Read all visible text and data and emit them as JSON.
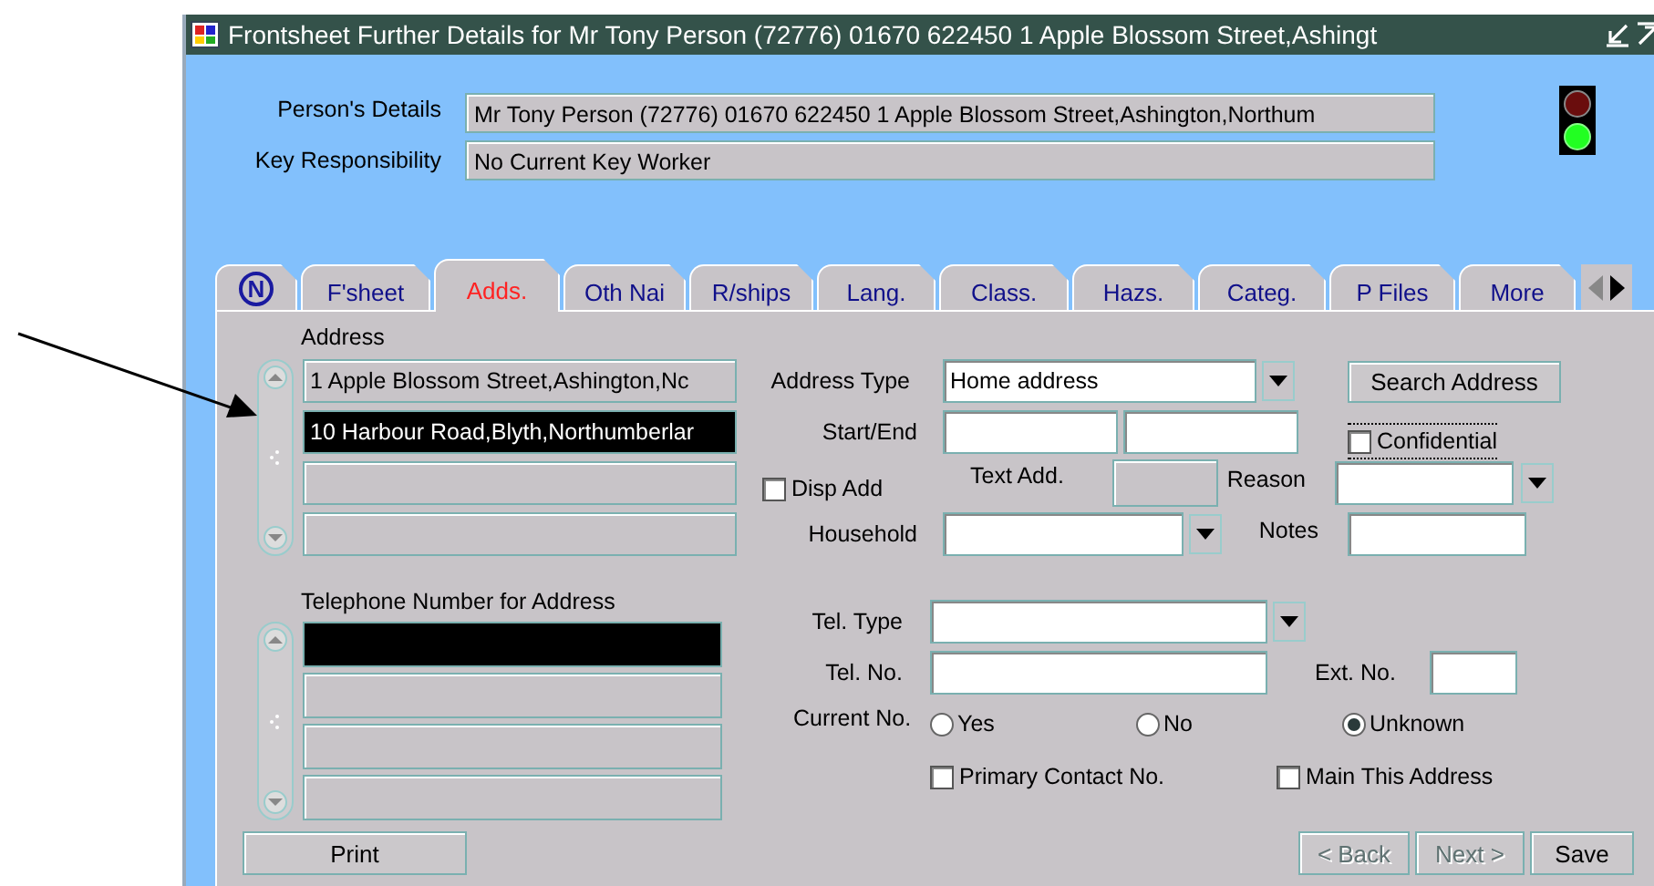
{
  "window": {
    "title": "Frontsheet Further Details for  Mr Tony Person (72776) 01670 622450 1 Apple Blossom Street,Ashingt"
  },
  "header": {
    "fields": [
      {
        "label": "Person's Details",
        "value": "Mr Tony Person (72776) 01670 622450 1  Apple Blossom Street,Ashington,Northum"
      },
      {
        "label": "Key Responsibility",
        "value": "No Current Key Worker"
      }
    ],
    "traffic_light": {
      "red_lit": false,
      "green_lit": true
    }
  },
  "tabs": [
    {
      "kind": "icon",
      "label": "N",
      "selected": false
    },
    {
      "kind": "text",
      "label": "F'sheet",
      "selected": false
    },
    {
      "kind": "text",
      "label": "Adds.",
      "selected": true
    },
    {
      "kind": "text",
      "label": "Oth Nai",
      "selected": false
    },
    {
      "kind": "text",
      "label": "R/ships",
      "selected": false
    },
    {
      "kind": "text",
      "label": "Lang.",
      "selected": false
    },
    {
      "kind": "text",
      "label": "Class.",
      "selected": false
    },
    {
      "kind": "text",
      "label": "Hazs.",
      "selected": false
    },
    {
      "kind": "text",
      "label": "Categ.",
      "selected": false
    },
    {
      "kind": "text",
      "label": "P Files",
      "selected": false
    },
    {
      "kind": "text",
      "label": "More",
      "selected": false
    }
  ],
  "address": {
    "label": "Address",
    "rows": [
      {
        "value": "1 Apple Blossom Street,Ashington,Nc",
        "selected": false
      },
      {
        "value": "10 Harbour Road,Blyth,Northumberlar",
        "selected": true
      },
      {
        "selected": false
      },
      {
        "selected": false
      }
    ],
    "address_type": {
      "label": "Address Type",
      "value": "Home address"
    },
    "search_button": {
      "label": "Search Address"
    },
    "start_end": {
      "label": "Start/End"
    },
    "confidential": {
      "label": "Confidential",
      "checked": false
    },
    "disp_add": {
      "label": "Disp Add",
      "checked": false
    },
    "text_add": {
      "label": "Text Add."
    },
    "reason": {
      "label": "Reason"
    },
    "household": {
      "label": "Household"
    },
    "notes": {
      "label": "Notes"
    }
  },
  "telephone": {
    "label": "Telephone Number for Address",
    "rows": [
      {
        "selected": true
      },
      {
        "selected": false
      },
      {
        "selected": false
      },
      {
        "selected": false
      }
    ],
    "tel_type": {
      "label": "Tel. Type"
    },
    "tel_no": {
      "label": "Tel. No."
    },
    "ext_no": {
      "label": "Ext. No."
    },
    "current_no": {
      "label": "Current No.",
      "options": [
        {
          "label": "Yes",
          "selected": false
        },
        {
          "label": "No",
          "selected": false
        },
        {
          "label": "Unknown",
          "selected": true
        }
      ]
    },
    "primary_contact": {
      "label": "Primary Contact No.",
      "checked": false
    },
    "main_this_address": {
      "label": "Main This Address",
      "checked": false
    }
  },
  "print_button": {
    "label": "Print"
  },
  "nav_buttons": [
    {
      "label": "< Back",
      "disabled": true
    },
    {
      "label": "Next >",
      "disabled": true
    },
    {
      "label": "Save",
      "disabled": false
    }
  ]
}
